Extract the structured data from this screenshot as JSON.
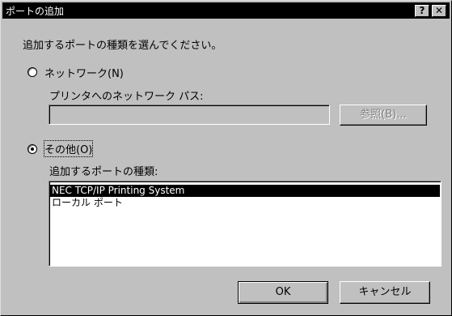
{
  "dialog": {
    "title": "ポートの追加",
    "help_label": "?",
    "close_label": "✕",
    "prompt": "追加するポートの種類を選んでください。"
  },
  "network_option": {
    "label": "ネットワーク(N)",
    "selected": false,
    "path_label": "プリンタへのネットワーク パス:",
    "path_value": "",
    "browse_label": "参照(B)..."
  },
  "other_option": {
    "label": "その他(O)",
    "selected": true,
    "types_label": "追加するポートの種類:",
    "port_types": [
      {
        "label": "NEC TCP/IP Printing System",
        "selected": true
      },
      {
        "label": "ローカル ポート",
        "selected": false
      }
    ]
  },
  "buttons": {
    "ok_label": "OK",
    "cancel_label": "キャンセル"
  },
  "colors": {
    "face": "#c0c0c0",
    "titlebar": "#000000",
    "selection": "#000000"
  }
}
